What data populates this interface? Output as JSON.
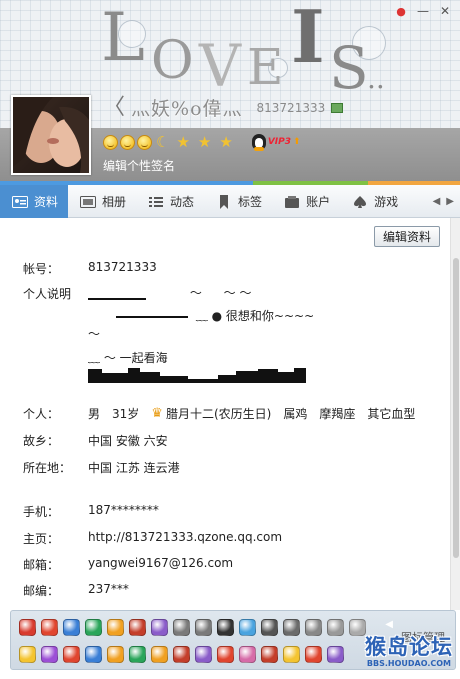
{
  "header": {
    "love_art": {
      "letter_l": "L",
      "letter_o": "O",
      "letter_v": "V",
      "letter_e": "E",
      "letter_i": "I",
      "letter_s": "S",
      "trail_dots": ".."
    },
    "nickname": "灬妖%o偉灬",
    "qq_number": "813721333",
    "signature_placeholder": "编辑个性签名",
    "vip_label": "VIP3",
    "vip_up_icon": "arrow-up"
  },
  "window_controls": {
    "pin_icon": "pin-icon",
    "minimize_label": "—",
    "close_label": "✕"
  },
  "tabs": [
    {
      "label": "资料",
      "icon": "profile-card-icon",
      "active": true
    },
    {
      "label": "相册",
      "icon": "photo-album-icon",
      "active": false
    },
    {
      "label": "动态",
      "icon": "feed-list-icon",
      "active": false
    },
    {
      "label": "标签",
      "icon": "bookmark-tag-icon",
      "active": false
    },
    {
      "label": "账户",
      "icon": "wallet-icon",
      "active": false
    },
    {
      "label": "游戏",
      "icon": "game-spade-icon",
      "active": false
    }
  ],
  "profile": {
    "edit_button": "编辑资料",
    "account": {
      "label": "帐号：",
      "value": "813721333"
    },
    "description": {
      "label": "个人说明",
      "lines": [
        "～",
        "～ ～",
        "﹏ ● 很想和你~~~~",
        "～",
        "﹏ ～ 一起看海"
      ]
    },
    "personal": {
      "label": "个人：",
      "gender": "男",
      "age": "31岁",
      "birthday": "腊月十二(农历生日)",
      "zodiac": "属鸡",
      "star_sign": "摩羯座",
      "blood_type": "其它血型"
    },
    "hometown": {
      "label": "故乡：",
      "value": "中国 安徽 六安"
    },
    "location": {
      "label": "所在地：",
      "value": "中国 江苏 连云港"
    },
    "mobile": {
      "label": "手机：",
      "value": "187********"
    },
    "homepage": {
      "label": "主页：",
      "value": "http://813721333.qzone.qq.com"
    },
    "email": {
      "label": "邮箱：",
      "value": "yangwei9167@126.com"
    },
    "postcode": {
      "label": "邮编：",
      "value": "237***"
    }
  },
  "emoticon_bar": {
    "manage_label": "图标管理",
    "watermark": "猴岛论坛",
    "watermark_url": "BBS.HOUDAO.COM",
    "row1_colors": [
      "#d83b2e",
      "#e0452f",
      "#3a7fd6",
      "#2aa55a",
      "#f0a021",
      "#c43e2a",
      "#8a5cc9",
      "#7a7a7a",
      "#7a7a7a",
      "#333333",
      "#4aa3df",
      "#555555",
      "#6b6b6b",
      "#888888",
      "#999999",
      "#aaaaaa"
    ],
    "row2_colors": [
      "#f4c430",
      "#9c4fd6",
      "#e0452f",
      "#3a7fd6",
      "#f0a021",
      "#2aa55a",
      "#f0a021",
      "#c43e2a",
      "#8a5cc9",
      "#e0452f",
      "#d66ba8",
      "#c43e2a",
      "#f4c430",
      "#e0452f",
      "#8a5cc9"
    ]
  }
}
